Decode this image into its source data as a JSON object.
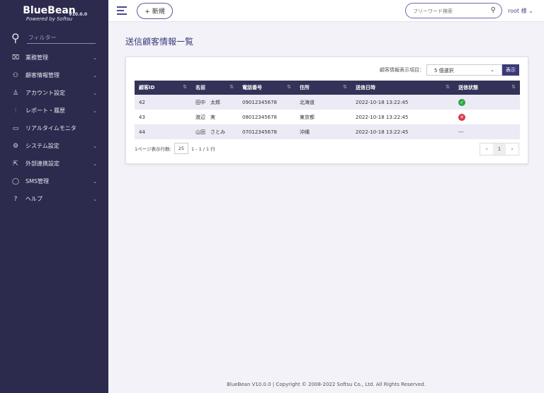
{
  "brand": {
    "name": "BlueBean",
    "tagline": "Powered by Softsu",
    "version": "V10.0.0"
  },
  "sidebar": {
    "filter_placeholder": "フィルター",
    "items": [
      {
        "icon": "briefcase-icon",
        "glyph": "⌧",
        "label": "業務管理",
        "chevron": true
      },
      {
        "icon": "users-icon",
        "glyph": "⚇",
        "label": "顧客情報管理",
        "chevron": true
      },
      {
        "icon": "user-icon",
        "glyph": "♙",
        "label": "アカウント設定",
        "chevron": true
      },
      {
        "icon": "bar-chart-icon",
        "glyph": "⫶",
        "label": "レポート・履歴",
        "chevron": true
      },
      {
        "icon": "monitor-icon",
        "glyph": "▭",
        "label": "リアルタイムモニタ",
        "chevron": false
      },
      {
        "icon": "gear-icon",
        "glyph": "⚙",
        "label": "システム設定",
        "chevron": true
      },
      {
        "icon": "external-link-icon",
        "glyph": "⇱",
        "label": "外部連携設定",
        "chevron": true
      },
      {
        "icon": "chat-icon",
        "glyph": "◯",
        "label": "SMS管理",
        "chevron": true
      },
      {
        "icon": "help-icon",
        "glyph": "?",
        "label": "ヘルプ",
        "chevron": true
      }
    ]
  },
  "header": {
    "new_label": "+ 新規",
    "search_placeholder": "フリーワード検索",
    "user": "root 様"
  },
  "page": {
    "title": "送信顧客情報一覧",
    "select_label": "顧客情報表示項目：",
    "select_value": "5 個選択",
    "show_button": "表示",
    "columns": [
      "顧客ID",
      "名前",
      "電話番号",
      "住所",
      "送信日時",
      "送信状態"
    ],
    "rows": [
      {
        "id": "42",
        "name": "田中　太郎",
        "phone": "09012345678",
        "address": "北海道",
        "sent_at": "2022-10-18 13:22:45",
        "status": "success"
      },
      {
        "id": "43",
        "name": "渡辺　実",
        "phone": "08012345678",
        "address": "東京都",
        "sent_at": "2022-10-18 13:22:45",
        "status": "failed"
      },
      {
        "id": "44",
        "name": "山田　さとみ",
        "phone": "07012345678",
        "address": "沖縄",
        "sent_at": "2022-10-18 13:22:45",
        "status": "---"
      }
    ],
    "rows_per_page_label": "1ページ表示行数:",
    "rows_per_page": "25",
    "range": "1 - 1 / 1 行",
    "current_page": "1"
  },
  "footer": "BlueBean V10.0.0 | Copyright © 2008-2022 Softsu Co., Ltd. All Rights Reserved."
}
